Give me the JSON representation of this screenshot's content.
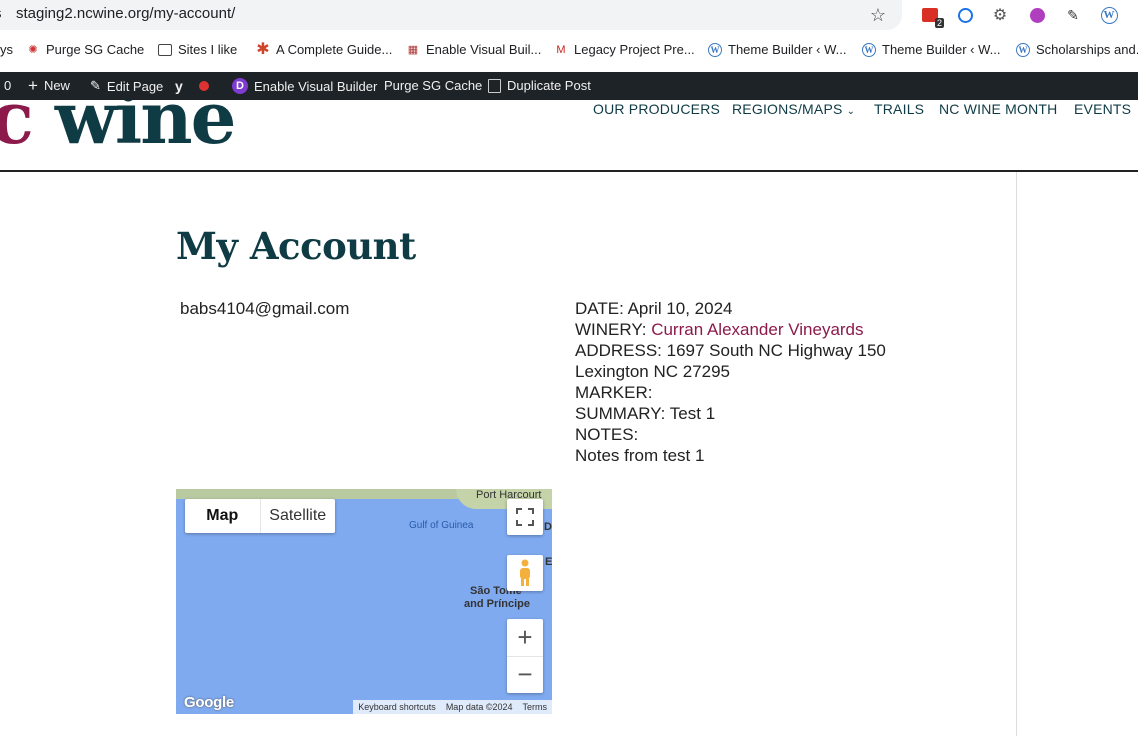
{
  "browser": {
    "url_prefix": "s",
    "url": "staging2.ncwine.org/my-account/",
    "extension_badge": "2"
  },
  "bookmarks": [
    {
      "label": "ys"
    },
    {
      "label": "Purge SG Cache"
    },
    {
      "label": "Sites I like"
    },
    {
      "label": "A Complete Guide..."
    },
    {
      "label": "Enable Visual Buil..."
    },
    {
      "label": "Legacy Project Pre..."
    },
    {
      "label": "Theme Builder ‹ W..."
    },
    {
      "label": "Theme Builder ‹ W..."
    },
    {
      "label": "Scholarships and..."
    }
  ],
  "adminbar": {
    "count": "0",
    "new": "New",
    "edit_page": "Edit Page",
    "enable_visual_builder": "Enable Visual Builder",
    "purge_cache": "Purge SG Cache",
    "duplicate_post": "Duplicate Post"
  },
  "site": {
    "logo_c": "c",
    "logo_rest": " wine",
    "nav": [
      "OUR PRODUCERS",
      "REGIONS/MAPS",
      "TRAILS",
      "NC WINE MONTH",
      "EVENTS"
    ]
  },
  "page": {
    "title": "My Account",
    "email": "babs4104@gmail.com"
  },
  "details": {
    "date": "DATE: April 10, 2024",
    "winery_label": "WINERY: ",
    "winery_name": "Curran Alexander Vineyards",
    "address": "ADDRESS: 1697 South NC Highway 150",
    "city": "Lexington NC 27295",
    "marker": "MARKER:",
    "summary": "SUMMARY: Test 1",
    "notes_label": "NOTES:",
    "notes": "Notes from test 1"
  },
  "map": {
    "tab_map": "Map",
    "tab_satellite": "Satellite",
    "label_port": "Port Harcourt",
    "label_gulf": "Gulf of Guinea",
    "label_saotome_1": "São Tomé",
    "label_saotome_2": "and Príncipe",
    "label_d": "D",
    "label_e": "E",
    "google": "Google",
    "footer_shortcuts": "Keyboard shortcuts",
    "footer_data": "Map data ©2024",
    "footer_terms": "Terms",
    "zoom_in": "+",
    "zoom_out": "−"
  },
  "colors": {
    "brand_dark": "#0f3b45",
    "brand_wine": "#8c1a4b",
    "admin_bar": "#1d2327",
    "map_water": "#7faaf0"
  }
}
